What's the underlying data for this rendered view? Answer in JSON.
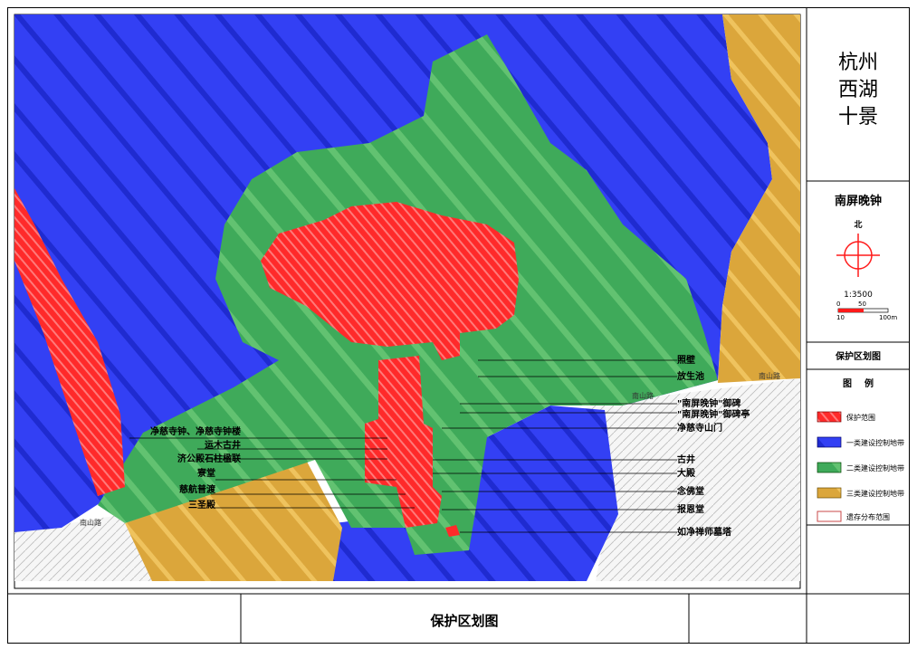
{
  "title_block": {
    "city_title_lines": [
      "杭州",
      "西湖",
      "十景"
    ],
    "scene_name": "南屏晚钟",
    "north_label": "北",
    "scale_text": "1:3500",
    "scale_ticks": [
      "0",
      "10",
      "50",
      "100m"
    ],
    "section_title": "保护区划图",
    "legend_heading": "图    例",
    "footer_title": "保护区划图"
  },
  "legend": [
    {
      "label": "保护范围",
      "color": "#ff3b3b",
      "icon": "red-hatch-swatch"
    },
    {
      "label": "一类建设控制地带",
      "color": "#2f3bff",
      "icon": "blue-hatch-swatch"
    },
    {
      "label": "二类建设控制地带",
      "color": "#3fa85a",
      "icon": "green-hatch-swatch"
    },
    {
      "label": "三类建设控制地带",
      "color": "#d8a63a",
      "icon": "yellow-hatch-swatch"
    },
    {
      "label": "遗存分布范围",
      "color": "#c84a4a",
      "icon": "outline-swatch"
    }
  ],
  "map_labels": {
    "left": [
      "净慈寺钟、净慈寺钟楼",
      "运木古井",
      "济公殿石柱楹联",
      "寮堂",
      "慈航普渡",
      "三圣殿"
    ],
    "right": [
      "照壁",
      "放生池",
      "\"南屏晚钟\"御碑",
      "\"南屏晚钟\"御碑亭",
      "净慈寺山门",
      "古井",
      "大殿",
      "念佛堂",
      "报恩堂",
      "如净禅师墓塔"
    ],
    "road_labels": [
      "南山路",
      "南山路",
      "南山路"
    ]
  }
}
